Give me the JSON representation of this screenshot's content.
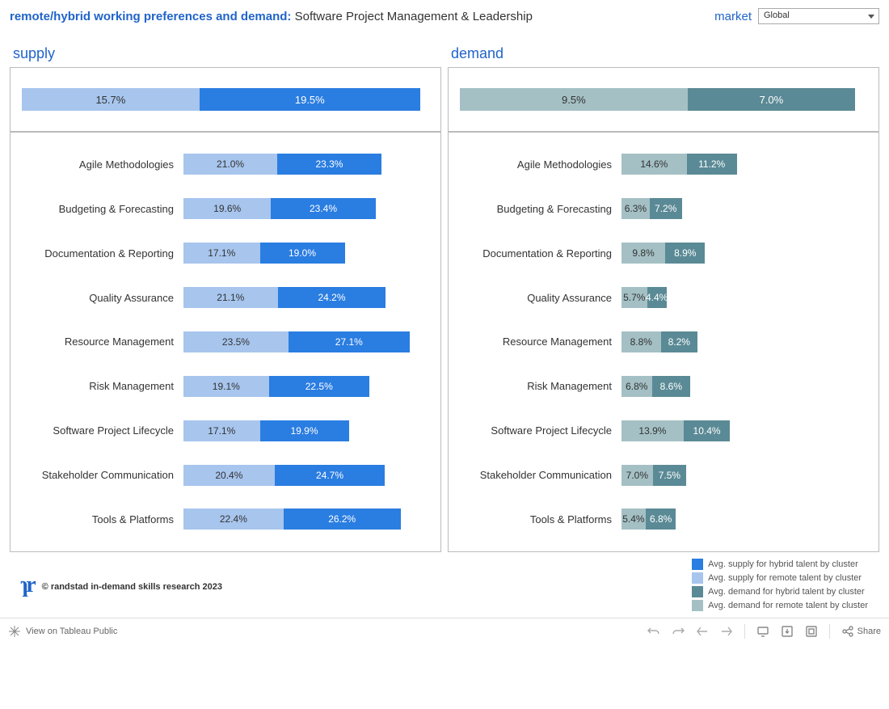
{
  "header": {
    "title_prefix": "remote/hybrid working preferences and demand:",
    "title_suffix": " Software Project Management & Leadership",
    "market_label": "market",
    "market_value": "Global"
  },
  "panels": {
    "supply": {
      "title": "supply",
      "summary": {
        "remote": 15.7,
        "hybrid": 19.5
      },
      "max": 55,
      "rows": [
        {
          "label": "Agile Methodologies",
          "remote": 21.0,
          "hybrid": 23.3
        },
        {
          "label": "Budgeting & Forecasting",
          "remote": 19.6,
          "hybrid": 23.4
        },
        {
          "label": "Documentation & Reporting",
          "remote": 17.1,
          "hybrid": 19.0
        },
        {
          "label": "Quality Assurance",
          "remote": 21.1,
          "hybrid": 24.2
        },
        {
          "label": "Resource Management",
          "remote": 23.5,
          "hybrid": 27.1
        },
        {
          "label": "Risk Management",
          "remote": 19.1,
          "hybrid": 22.5
        },
        {
          "label": "Software Project Lifecycle",
          "remote": 17.1,
          "hybrid": 19.9
        },
        {
          "label": "Stakeholder Communication",
          "remote": 20.4,
          "hybrid": 24.7
        },
        {
          "label": "Tools & Platforms",
          "remote": 22.4,
          "hybrid": 26.2
        }
      ]
    },
    "demand": {
      "title": "demand",
      "summary": {
        "remote": 9.5,
        "hybrid": 7.0
      },
      "max": 55,
      "rows": [
        {
          "label": "Agile Methodologies",
          "remote": 14.6,
          "hybrid": 11.2
        },
        {
          "label": "Budgeting & Forecasting",
          "remote": 6.3,
          "hybrid": 7.2
        },
        {
          "label": "Documentation & Reporting",
          "remote": 9.8,
          "hybrid": 8.9
        },
        {
          "label": "Quality Assurance",
          "remote": 5.7,
          "hybrid": 4.4
        },
        {
          "label": "Resource Management",
          "remote": 8.8,
          "hybrid": 8.2
        },
        {
          "label": "Risk Management",
          "remote": 6.8,
          "hybrid": 8.6
        },
        {
          "label": "Software Project Lifecycle",
          "remote": 13.9,
          "hybrid": 10.4
        },
        {
          "label": "Stakeholder Communication",
          "remote": 7.0,
          "hybrid": 7.5
        },
        {
          "label": "Tools & Platforms",
          "remote": 5.4,
          "hybrid": 6.8
        }
      ]
    }
  },
  "legend": [
    {
      "color": "#2a7de1",
      "label": "Avg. supply for hybrid talent by cluster"
    },
    {
      "color": "#a7c5ed",
      "label": "Avg. supply for remote talent by cluster"
    },
    {
      "color": "#5a8a95",
      "label": "Avg. demand for hybrid talent by cluster"
    },
    {
      "color": "#a4c0c4",
      "label": "Avg. demand for remote talent by cluster"
    }
  ],
  "footer": {
    "copyright": "© randstad in-demand skills research 2023"
  },
  "toolbar": {
    "view_label": "View on Tableau Public",
    "share_label": "Share"
  },
  "chart_data": {
    "type": "bar",
    "title": "remote/hybrid working preferences and demand: Software Project Management & Leadership",
    "xlabel": "",
    "ylabel": "",
    "panels": [
      {
        "name": "supply",
        "summary": {
          "remote_pct": 15.7,
          "hybrid_pct": 19.5
        },
        "categories": [
          "Agile Methodologies",
          "Budgeting & Forecasting",
          "Documentation & Reporting",
          "Quality Assurance",
          "Resource Management",
          "Risk Management",
          "Software Project Lifecycle",
          "Stakeholder Communication",
          "Tools & Platforms"
        ],
        "series": [
          {
            "name": "Avg. supply for remote talent by cluster",
            "values": [
              21.0,
              19.6,
              17.1,
              21.1,
              23.5,
              19.1,
              17.1,
              20.4,
              22.4
            ]
          },
          {
            "name": "Avg. supply for hybrid talent by cluster",
            "values": [
              23.3,
              23.4,
              19.0,
              24.2,
              27.1,
              22.5,
              19.9,
              24.7,
              26.2
            ]
          }
        ]
      },
      {
        "name": "demand",
        "summary": {
          "remote_pct": 9.5,
          "hybrid_pct": 7.0
        },
        "categories": [
          "Agile Methodologies",
          "Budgeting & Forecasting",
          "Documentation & Reporting",
          "Quality Assurance",
          "Resource Management",
          "Risk Management",
          "Software Project Lifecycle",
          "Stakeholder Communication",
          "Tools & Platforms"
        ],
        "series": [
          {
            "name": "Avg. demand for remote talent by cluster",
            "values": [
              14.6,
              6.3,
              9.8,
              5.7,
              8.8,
              6.8,
              13.9,
              7.0,
              5.4
            ]
          },
          {
            "name": "Avg. demand for hybrid talent by cluster",
            "values": [
              11.2,
              7.2,
              8.9,
              4.4,
              8.2,
              8.6,
              10.4,
              7.5,
              6.8
            ]
          }
        ]
      }
    ]
  }
}
